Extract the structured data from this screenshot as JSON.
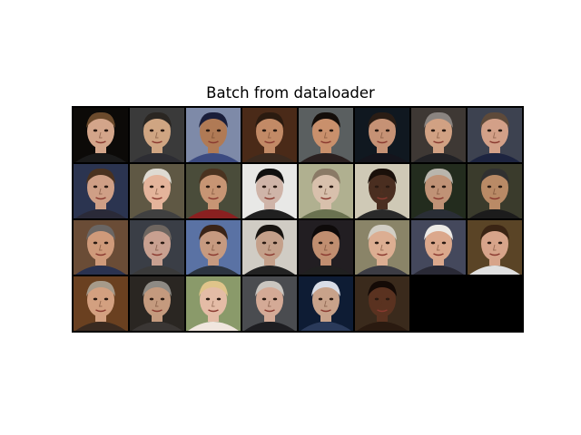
{
  "title": "Batch from dataloader",
  "grid": {
    "rows": 4,
    "cols": 8,
    "cells": [
      {
        "bg": "#0c0a08",
        "skin": "#d3a58a",
        "hair": "#6b4a2c",
        "shirt": "#1a1a1a"
      },
      {
        "bg": "#3a3a3a",
        "skin": "#cfa582",
        "hair": "#2a2622",
        "shirt": "#2d2d33"
      },
      {
        "bg": "#7e8aa8",
        "skin": "#b07a55",
        "hair": "#1a1e3a",
        "shirt": "#3b4a80"
      },
      {
        "bg": "#4a2a18",
        "skin": "#c28a66",
        "hair": "#2b1b10",
        "shirt": "#3b2a1f"
      },
      {
        "bg": "#5a5f60",
        "skin": "#c9906c",
        "hair": "#140e0a",
        "shirt": "#2a2020"
      },
      {
        "bg": "#101820",
        "skin": "#c69275",
        "hair": "#2a1d15",
        "shirt": "#14141c"
      },
      {
        "bg": "#3e3834",
        "skin": "#d1a183",
        "hair": "#8a8480",
        "shirt": "#222226"
      },
      {
        "bg": "#3d4250",
        "skin": "#d3a088",
        "hair": "#5e4a3a",
        "shirt": "#1d2440"
      },
      {
        "bg": "#2b3450",
        "skin": "#cf9f86",
        "hair": "#4a3220",
        "shirt": "#2a2a38"
      },
      {
        "bg": "#5f5844",
        "skin": "#e4b49b",
        "hair": "#dedad2",
        "shirt": "#404040"
      },
      {
        "bg": "#4a4c3a",
        "skin": "#c79574",
        "hair": "#4a3320",
        "shirt": "#8a2020"
      },
      {
        "bg": "#e8e8e6",
        "skin": "#cfb4a8",
        "hair": "#101010",
        "shirt": "#202020"
      },
      {
        "bg": "#b0b090",
        "skin": "#d8c0ac",
        "hair": "#8a7a66",
        "shirt": "#6a7250"
      },
      {
        "bg": "#cfc9b6",
        "skin": "#4a2e20",
        "hair": "#1a100a",
        "shirt": "#2a2a2a"
      },
      {
        "bg": "#232c1e",
        "skin": "#c09276",
        "hair": "#b9b5ad",
        "shirt": "#2a2e36"
      },
      {
        "bg": "#3a3b2c",
        "skin": "#b98a66",
        "hair": "#303030",
        "shirt": "#1c1c1c"
      },
      {
        "bg": "#6a4c36",
        "skin": "#cf9a7a",
        "hair": "#6a6664",
        "shirt": "#2a3250"
      },
      {
        "bg": "#3a3e46",
        "skin": "#c8a090",
        "hair": "#6e6660",
        "shirt": "#3a3a3a"
      },
      {
        "bg": "#5a72a4",
        "skin": "#c69a80",
        "hair": "#3a2418",
        "shirt": "#2c3440"
      },
      {
        "bg": "#d0ccc4",
        "skin": "#c4a08a",
        "hair": "#181410",
        "shirt": "#222"
      },
      {
        "bg": "#221e22",
        "skin": "#c08e70",
        "hair": "#0e0a0a",
        "shirt": "#202020"
      },
      {
        "bg": "#8a8468",
        "skin": "#dcae92",
        "hair": "#d2cec4",
        "shirt": "#3c3c44"
      },
      {
        "bg": "#44485c",
        "skin": "#dba88c",
        "hair": "#eceae6",
        "shirt": "#2a2a36"
      },
      {
        "bg": "#5a4426",
        "skin": "#d7a48a",
        "hair": "#3a2414",
        "shirt": "#e0e0e0"
      },
      {
        "bg": "#6a4020",
        "skin": "#d3a080",
        "hair": "#a69a8a",
        "shirt": "#3a2a20"
      },
      {
        "bg": "#2a2622",
        "skin": "#c49a7e",
        "hair": "#8e8a84",
        "shirt": "#3a3634"
      },
      {
        "bg": "#8a9a6a",
        "skin": "#e4bca6",
        "hair": "#e0c48a",
        "shirt": "#f0e6de"
      },
      {
        "bg": "#4a4c50",
        "skin": "#d4aa96",
        "hair": "#cac6c0",
        "shirt": "#1e1e22"
      },
      {
        "bg": "#0e1c34",
        "skin": "#c8a28a",
        "hair": "#d8dce6",
        "shirt": "#2a3a5a"
      },
      {
        "bg": "#3a2a1c",
        "skin": "#5a3220",
        "hair": "#140a06",
        "shirt": "#2a1a10"
      },
      {
        "bg": "#000000",
        "empty": true
      },
      {
        "bg": "#000000",
        "empty": true
      }
    ]
  }
}
